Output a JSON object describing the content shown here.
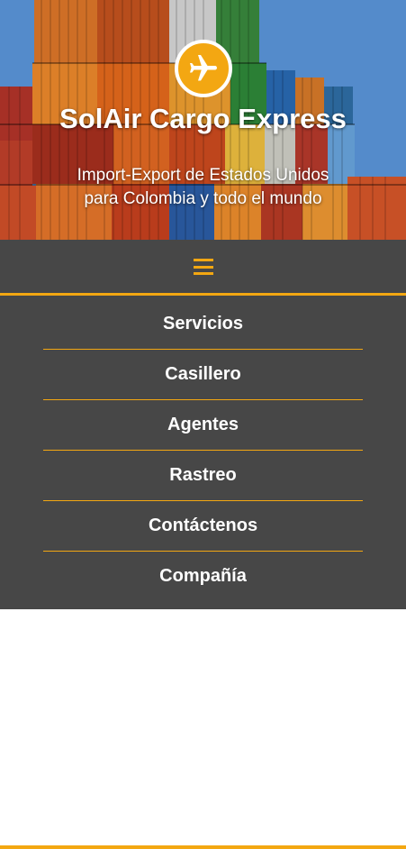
{
  "hero": {
    "title": "SolAir Cargo Express",
    "subtitle_line1": "Import-Export de Estados Unidos",
    "subtitle_line2": "para Colombia y todo el mundo",
    "logo_icon": "airplane-icon",
    "background_image": "shipping-containers-photo"
  },
  "nav": {
    "toggle_icon": "hamburger-menu-icon",
    "items": [
      {
        "label": "Servicios"
      },
      {
        "label": "Casillero"
      },
      {
        "label": "Agentes"
      },
      {
        "label": "Rastreo"
      },
      {
        "label": "Contáctenos"
      },
      {
        "label": "Compañía"
      }
    ]
  },
  "colors": {
    "accent": "#f3a712",
    "nav_background": "#474747",
    "text": "#ffffff"
  }
}
